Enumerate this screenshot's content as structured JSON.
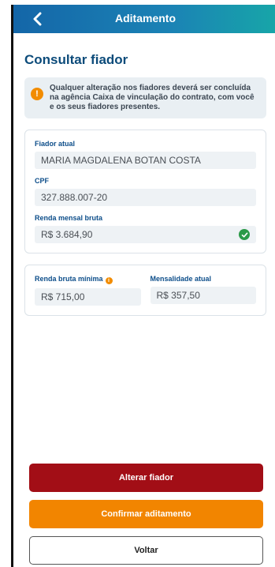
{
  "header": {
    "title": "Aditamento",
    "back_icon": "chevron-left-icon"
  },
  "page": {
    "title": "Consultar fiador"
  },
  "notice": {
    "icon": "exclamation-icon",
    "text": "Qualquer alteração nos fiadores deverá ser concluída na agência Caixa de vinculação do contrato, com você e os seus fiadores presentes."
  },
  "guarantor": {
    "name_label": "Fiador atual",
    "name_value": "MARIA MAGDALENA BOTAN COSTA",
    "cpf_label": "CPF",
    "cpf_value": "327.888.007-20",
    "income_label": "Renda mensal bruta",
    "income_value": "R$ 3.684,90",
    "income_status_icon": "check-circle-icon"
  },
  "summary": {
    "min_income_label": "Renda bruta mínima",
    "min_income_value": "R$ 715,00",
    "monthly_label": "Mensalidade atual",
    "monthly_value": "R$ 357,50"
  },
  "actions": {
    "change_label": "Alterar fiador",
    "confirm_label": "Confirmar aditamento",
    "back_label": "Voltar"
  },
  "colors": {
    "primary": "#0c4b7a",
    "danger": "#a20e16",
    "accent": "#f28500",
    "success": "#2b9a48"
  }
}
